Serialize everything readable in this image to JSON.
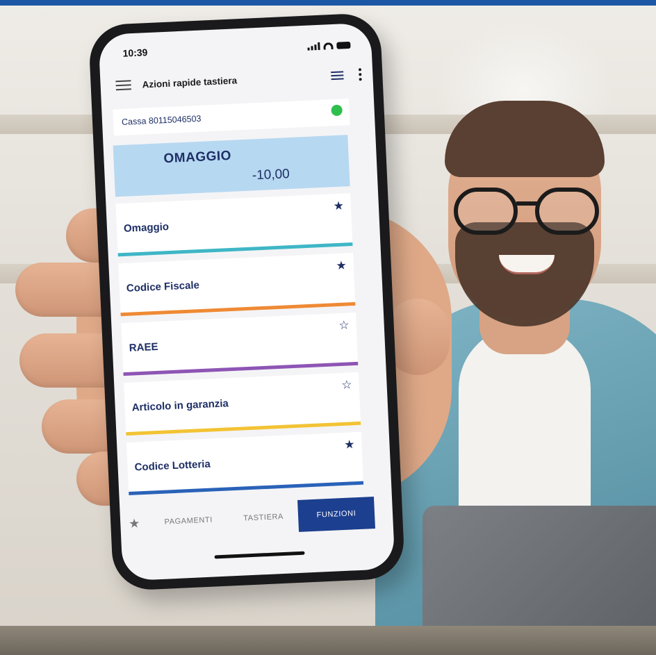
{
  "status_bar": {
    "time": "10:39"
  },
  "app_bar": {
    "title": "Azioni rapide tastiera"
  },
  "register": {
    "label": "Cassa 80115046503",
    "status_color": "#2ebf4f"
  },
  "display": {
    "item_name": "OMAGGIO",
    "amount": "-10,00"
  },
  "actions": [
    {
      "label": "Omaggio",
      "favorite": true,
      "accent_color": "#3fb6c6",
      "star": "★"
    },
    {
      "label": "Codice Fiscale",
      "favorite": true,
      "accent_color": "#ee8a34",
      "star": "★"
    },
    {
      "label": "RAEE",
      "favorite": false,
      "accent_color": "#8e55b4",
      "star": "☆"
    },
    {
      "label": "Articolo in garanzia",
      "favorite": false,
      "accent_color": "#f2c334",
      "star": "☆"
    },
    {
      "label": "Codice Lotteria",
      "favorite": true,
      "accent_color": "#2a62b8",
      "star": "★"
    }
  ],
  "tabs": {
    "favorites_icon": "★",
    "payments": "PAGAMENTI",
    "keyboard": "TASTIERA",
    "functions": "FUNZIONI",
    "active": "FUNZIONI"
  },
  "colors": {
    "brand": "#1c3f8f",
    "text_primary": "#1e2f66",
    "display_bg": "#b7d8f1"
  }
}
